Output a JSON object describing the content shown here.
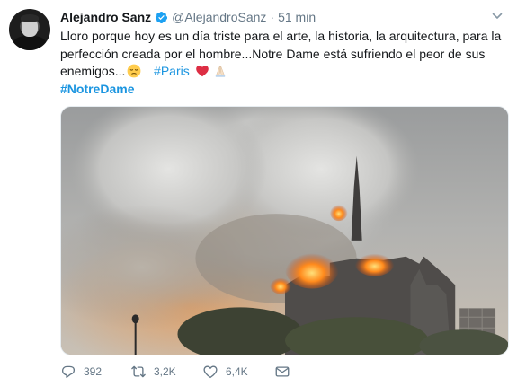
{
  "tweet": {
    "author": {
      "name": "Alejandro Sanz",
      "handle": "@AlejandroSanz",
      "verified": true
    },
    "time": "51 min",
    "dot": "·",
    "text": {
      "line1": "Lloro porque hoy es un día triste para el arte, la historia, la arquitectura, para la",
      "line2": "perfección creada por el hombre...Notre Dame está sufriendo el peor de sus",
      "line3_text": "enemigos...",
      "hashtag_paris": "#Paris",
      "hashtag_notredame": "#NotreDame",
      "emojis": [
        "sad-relieved-face-emoji",
        "red-heart-emoji",
        "folded-hands-emoji"
      ]
    },
    "actions": {
      "replies": "392",
      "retweets": "3,2K",
      "likes": "6,4K"
    },
    "colors": {
      "hashtag": "#1b95e0",
      "verified": "#1da1f2",
      "muted": "#657786"
    }
  }
}
